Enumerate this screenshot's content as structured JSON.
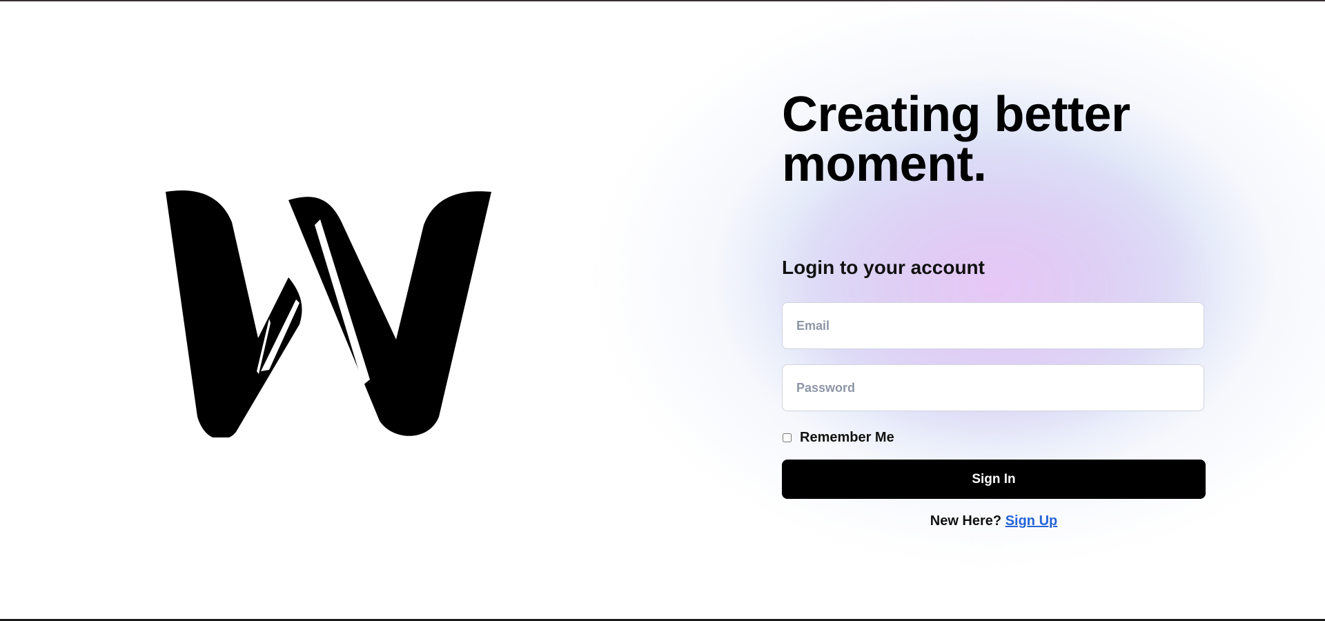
{
  "brand": {
    "logo_icon": "w-logo-icon"
  },
  "hero": {
    "headline": "Creating better moment."
  },
  "login": {
    "heading": "Login to your account",
    "email_placeholder": "Email",
    "password_placeholder": "Password",
    "remember_label": "Remember Me",
    "remember_checked": false,
    "signin_label": "Sign In",
    "signup_prompt": "New Here?",
    "signup_link": "Sign Up"
  },
  "colors": {
    "primary_button": "#000000",
    "link": "#2563d6",
    "glow_pink": "#e8c6f6",
    "glow_blue": "#cdd8f4"
  }
}
